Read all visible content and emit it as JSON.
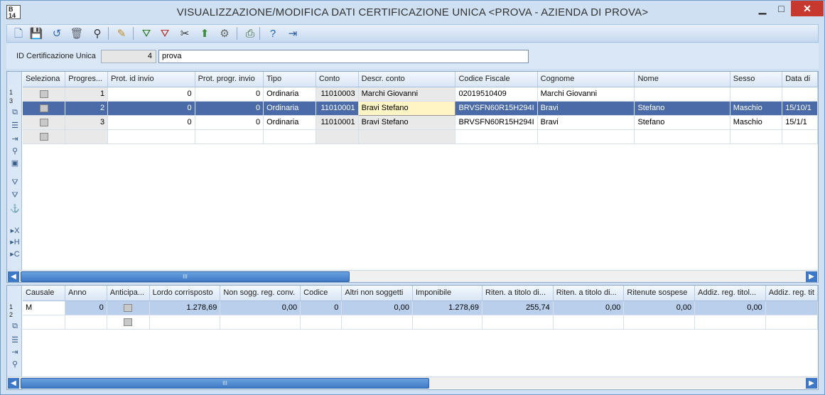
{
  "window": {
    "title": "VISUALIZZAZIONE/MODIFICA DATI CERTIFICAZIONE UNICA <PROVA - AZIENDA DI PROVA>",
    "icon_text": "B\n14",
    "minimize": "▁",
    "maximize": "□",
    "close": "✕"
  },
  "toolbar": {
    "buttons": [
      {
        "name": "new-icon",
        "glyph": "🗋",
        "color": "#4a6fa8"
      },
      {
        "name": "save-icon",
        "glyph": "💾",
        "color": "#2c4f86"
      },
      {
        "name": "undo-icon",
        "glyph": "↺",
        "color": "#2f6cc4"
      },
      {
        "name": "delete-icon",
        "glyph": "🗑",
        "color": "#5d6470"
      },
      {
        "name": "find-icon",
        "glyph": "⚲",
        "color": "#333"
      },
      {
        "name": "edit-icon",
        "glyph": "✎",
        "color": "#c08a2c"
      },
      {
        "name": "filter-add-icon",
        "glyph": "⛛",
        "color": "#2f7d33"
      },
      {
        "name": "filter-remove-icon",
        "glyph": "⛛",
        "color": "#b43131"
      },
      {
        "name": "cut-icon",
        "glyph": "✂",
        "color": "#333"
      },
      {
        "name": "export-icon",
        "glyph": "⬆",
        "color": "#3c8a3c"
      },
      {
        "name": "settings-icon",
        "glyph": "⚙",
        "color": "#666"
      },
      {
        "name": "print-icon",
        "glyph": "⎙",
        "color": "#3b5e2e"
      },
      {
        "name": "help-icon",
        "glyph": "?",
        "color": "#1e5fbf"
      },
      {
        "name": "exit-icon",
        "glyph": "⇥",
        "color": "#2f5f9f"
      }
    ]
  },
  "form": {
    "id_label": "ID Certificazione Unica",
    "id_value": "4",
    "description": "prova"
  },
  "grid1": {
    "columns": [
      "Seleziona",
      "Progres...",
      "Prot. id invio",
      "Prot. progr. invio",
      "Tipo",
      "Conto",
      "Descr. conto",
      "Codice Fiscale",
      "Cognome",
      "Nome",
      "Sesso",
      "Data di"
    ],
    "rows": [
      {
        "progressivo": "1",
        "prot_id": "0",
        "prot_progr": "0",
        "tipo": "Ordinaria",
        "conto": "11010003",
        "descr": "Marchi Giovanni",
        "cf": "02019510409",
        "cognome": "Marchi Giovanni",
        "nome": "",
        "sesso": "",
        "data": ""
      },
      {
        "progressivo": "2",
        "prot_id": "0",
        "prot_progr": "0",
        "tipo": "Ordinaria",
        "conto": "11010001",
        "descr": "Bravi Stefano",
        "cf": "BRVSFN60R15H294I",
        "cognome": "Bravi",
        "nome": "Stefano",
        "sesso": "Maschio",
        "data": "15/10/1"
      },
      {
        "progressivo": "3",
        "prot_id": "0",
        "prot_progr": "0",
        "tipo": "Ordinaria",
        "conto": "11010001",
        "descr": "Bravi Stefano",
        "cf": "BRVSFN60R15H294I",
        "cognome": "Bravi",
        "nome": "Stefano",
        "sesso": "Maschio",
        "data": "15/1/1"
      }
    ],
    "row_indicator": [
      "1",
      "3"
    ]
  },
  "grid2": {
    "columns": [
      "Causale",
      "Anno",
      "Anticipa...",
      "Lordo corrisposto",
      "Non sogg. reg. conv.",
      "Codice",
      "Altri non soggetti",
      "Imponibile",
      "Riten. a titolo di...",
      "Riten. a titolo di...",
      "Ritenute sospese",
      "Addiz. reg. titol...",
      "Addiz. reg. tit"
    ],
    "rows": [
      {
        "causale": "M",
        "anno": "0",
        "lordo": "1.278,69",
        "non_sogg": "0,00",
        "codice": "0",
        "altri": "0,00",
        "imponibile": "1.278,69",
        "riten1": "255,74",
        "riten2": "0,00",
        "sospese": "0,00",
        "addiz": "0,00",
        "addiz2": ""
      }
    ],
    "row_indicator": [
      "1",
      "2"
    ]
  },
  "scrollbar": {
    "thumb_label": "III"
  }
}
